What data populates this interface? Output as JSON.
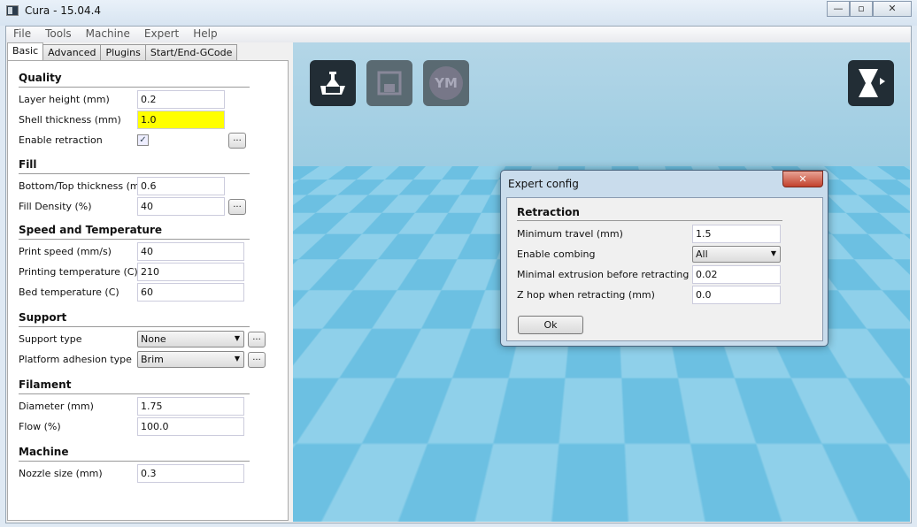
{
  "window": {
    "title": "Cura - 15.04.4",
    "minimize": "—",
    "maximize": "▫",
    "close": "✕"
  },
  "menu": [
    "File",
    "Tools",
    "Machine",
    "Expert",
    "Help"
  ],
  "tabs": [
    "Basic",
    "Advanced",
    "Plugins",
    "Start/End-GCode"
  ],
  "sections": [
    {
      "title": "Quality",
      "rows": [
        {
          "label": "Layer height (mm)",
          "type": "input",
          "value": "0.2"
        },
        {
          "label": "Shell thickness (mm)",
          "type": "input",
          "value": "1.0",
          "highlight": true
        },
        {
          "label": "Enable retraction",
          "type": "checkbox",
          "checked": true,
          "more": "..."
        }
      ]
    },
    {
      "title": "Fill",
      "rows": [
        {
          "label": "Bottom/Top thickness (mm)",
          "type": "input",
          "value": "0.6"
        },
        {
          "label": "Fill Density (%)",
          "type": "input",
          "value": "40",
          "more": "..."
        }
      ]
    },
    {
      "title": "Speed and Temperature",
      "rows": [
        {
          "label": "Print speed (mm/s)",
          "type": "input",
          "value": "40",
          "wide": true
        },
        {
          "label": "Printing temperature (C)",
          "type": "input",
          "value": "210",
          "wide": true
        },
        {
          "label": "Bed temperature (C)",
          "type": "input",
          "value": "60",
          "wide": true
        }
      ]
    },
    {
      "title": "Support",
      "rows": [
        {
          "label": "Support type",
          "type": "select",
          "value": "None",
          "more": "..."
        },
        {
          "label": "Platform adhesion type",
          "type": "select",
          "value": "Brim",
          "more": "..."
        }
      ]
    },
    {
      "title": "Filament",
      "rows": [
        {
          "label": "Diameter (mm)",
          "type": "input",
          "value": "1.75",
          "wide": true
        },
        {
          "label": "Flow (%)",
          "type": "input",
          "value": "100.0",
          "wide": true
        }
      ]
    },
    {
      "title": "Machine",
      "rows": [
        {
          "label": "Nozzle size (mm)",
          "type": "input",
          "value": "0.3",
          "wide": true
        }
      ]
    }
  ],
  "toolbar": {
    "load": "load-icon",
    "save": "save-icon",
    "youmagine": "YM",
    "view_mode": "view-mode-icon"
  },
  "dialog": {
    "title": "Expert config",
    "close": "✕",
    "section": "Retraction",
    "rows": [
      {
        "label": "Minimum travel (mm)",
        "type": "input",
        "value": "1.5"
      },
      {
        "label": "Enable combing",
        "type": "select",
        "value": "All"
      },
      {
        "label": "Minimal extrusion before retracting (mm)",
        "type": "input",
        "value": "0.02"
      },
      {
        "label": "Z hop when retracting (mm)",
        "type": "input",
        "value": "0.0"
      }
    ],
    "ok": "Ok"
  }
}
